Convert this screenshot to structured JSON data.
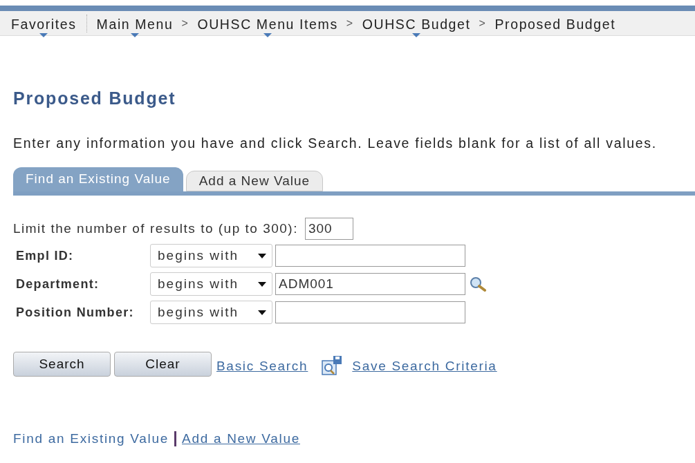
{
  "breadcrumbs": [
    {
      "label": "Favorites",
      "has_menu": true
    },
    {
      "label": "Main Menu",
      "has_menu": true
    },
    {
      "label": "OUHSC Menu Items",
      "has_menu": true
    },
    {
      "label": "OUHSC Budget",
      "has_menu": true
    },
    {
      "label": "Proposed Budget",
      "has_menu": false
    }
  ],
  "separator": ">",
  "title": "Proposed Budget",
  "instructions": "Enter any information you have and click Search. Leave fields blank for a list of all values.",
  "tabs": [
    {
      "label": "Find an Existing Value",
      "selected": true
    },
    {
      "label": "Add a New Value",
      "selected": false
    }
  ],
  "limit": {
    "label": "Limit the number of results to (up to 300):",
    "value": "300"
  },
  "criteria": [
    {
      "label": "Empl ID:",
      "operator": "begins with",
      "lookup": false
    },
    {
      "label": "Department:",
      "operator": "begins with",
      "value": "ADM001",
      "lookup": true
    },
    {
      "label": "Position Number:",
      "operator": "begins with",
      "lookup": false
    }
  ],
  "buttons": [
    "Search",
    "Clear"
  ],
  "links": {
    "basic_search": "Basic Search",
    "save_criteria": "Save Search Criteria"
  },
  "bottom_links": [
    {
      "label": "Find an Existing Value",
      "selected": true
    },
    {
      "label": "Add a New Value",
      "selected": false
    }
  ]
}
